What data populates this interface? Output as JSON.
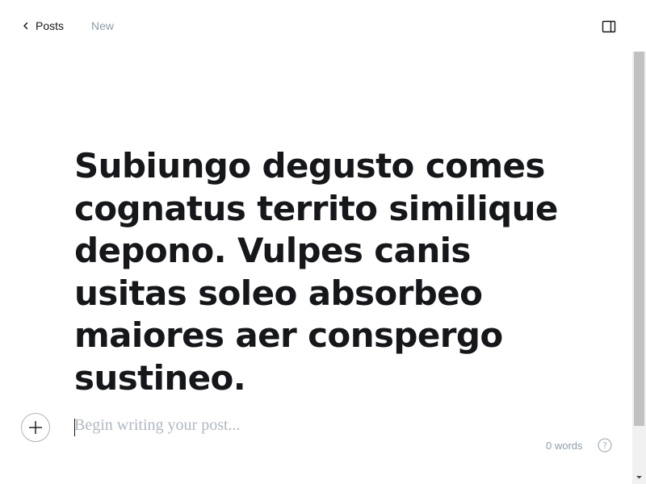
{
  "header": {
    "back_label": "Posts",
    "status": "New",
    "back_icon": "chevron-left-icon",
    "panel_icon": "sidebar-panel-icon"
  },
  "post": {
    "title": "Subiungo degusto comes cognatus territo similique depono. Vulpes canis usitas soleo absorbeo maiores aer conspergo sustineo.",
    "body_placeholder": "Begin writing your post..."
  },
  "footer": {
    "word_count": "0 words",
    "help_icon": "help-circle-icon"
  },
  "colors": {
    "text": "#15171a",
    "muted": "#8e9cac",
    "placeholder": "#b0b8c2"
  }
}
